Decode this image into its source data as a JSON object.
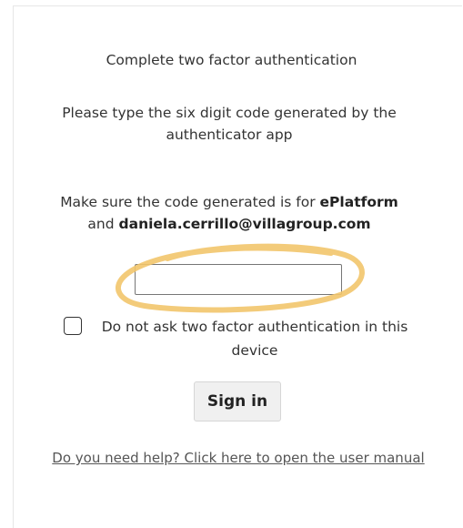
{
  "dialog": {
    "title": "Complete two factor authentication",
    "instructions": "Please type the six digit code generated by the authenticator app",
    "context_prefix": "Make sure the code generated is for ",
    "platform_name": "ePlatform",
    "context_middle": " and ",
    "user_email": "daniela.cerrillo@villagroup.com",
    "code_input": {
      "value": "",
      "placeholder": ""
    },
    "remember_checkbox": {
      "label": "Do not ask two factor authentication in this device",
      "checked": false
    },
    "signin_label": "Sign in",
    "help_link": "Do you need help? Click here to open the user manual"
  },
  "colors": {
    "highlight": "#f2c56b",
    "border": "#e6e6e6"
  }
}
